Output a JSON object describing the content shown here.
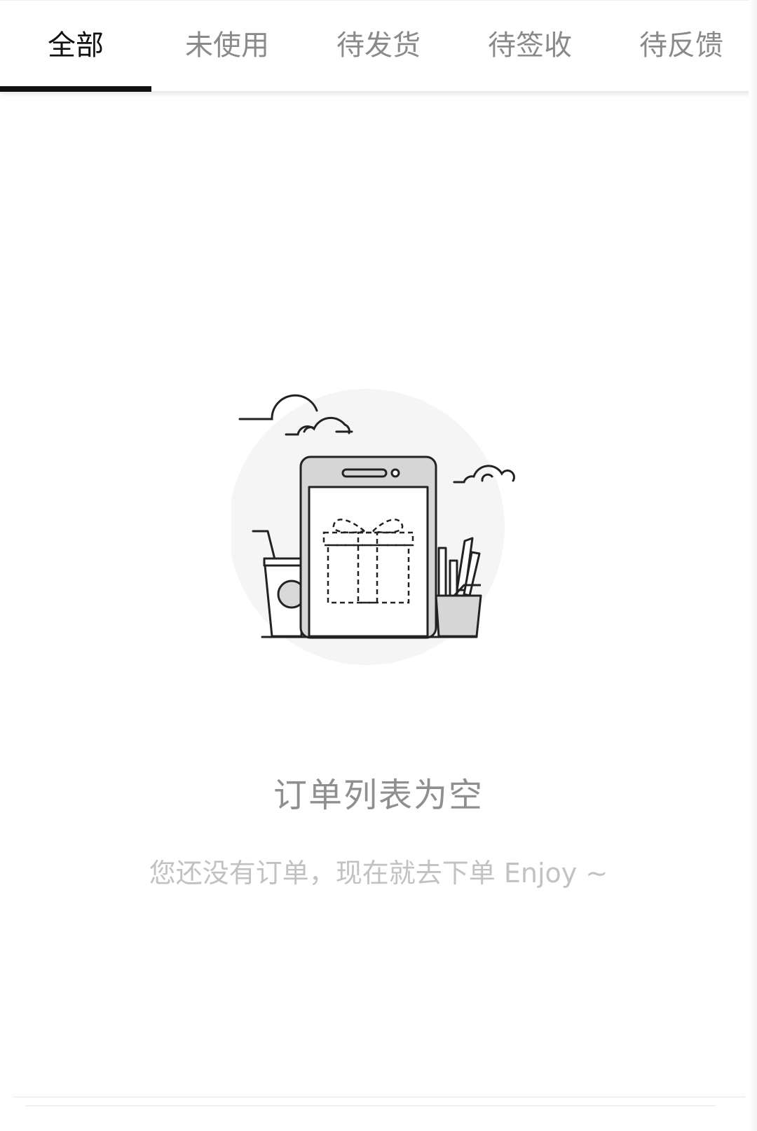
{
  "tabs": [
    {
      "label": "全部",
      "active": true
    },
    {
      "label": "未使用",
      "active": false
    },
    {
      "label": "待发货",
      "active": false
    },
    {
      "label": "待签收",
      "active": false
    },
    {
      "label": "待反馈",
      "active": false
    }
  ],
  "empty_state": {
    "illustration_icon": "empty-orders-illustration-icon",
    "title": "订单列表为空",
    "subtitle": "您还没有订单，现在就去下单 Enjoy ~"
  },
  "colors": {
    "active_tab": "#111111",
    "inactive_tab": "#8a8a8a",
    "title": "#8f8f8f",
    "subtitle": "#c2c2c2",
    "illustration_bg": "#f4f5f4"
  }
}
